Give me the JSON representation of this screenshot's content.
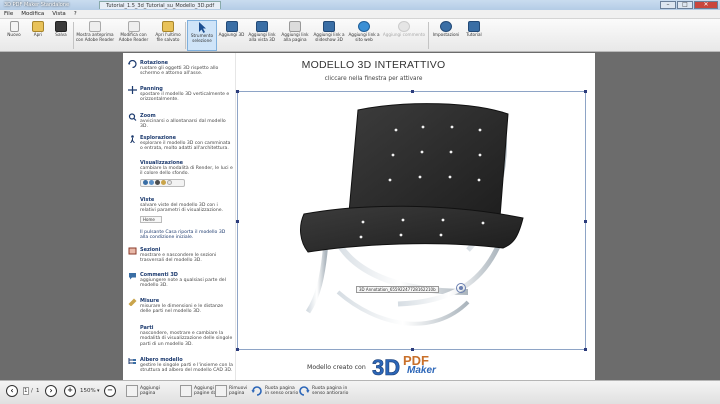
{
  "window": {
    "title": "3D PDF Maker Standalone",
    "document_tab": "Tutorial_1.5_3d_Tutorial_su_Modello_3D.pdf"
  },
  "menu": [
    "File",
    "Modifica",
    "Vista",
    "?"
  ],
  "toolbar": {
    "buttons": [
      {
        "label": "Nuovo",
        "icon": "new-document-icon",
        "state": "enabled"
      },
      {
        "label": "Apri",
        "icon": "folder-open-icon",
        "state": "enabled"
      },
      {
        "label": "Salva",
        "icon": "save-icon",
        "state": "enabled"
      },
      {
        "label": "Mostra anteprima con Adobe Reader",
        "icon": "preview-icon",
        "state": "enabled"
      },
      {
        "label": "Modifica con Adobe Reader",
        "icon": "edit-reader-icon",
        "state": "enabled"
      },
      {
        "label": "Apri l'ultimo file salvato",
        "icon": "open-last-icon",
        "state": "enabled"
      },
      {
        "label": "Strumento selezione",
        "icon": "cursor-icon",
        "state": "active"
      },
      {
        "label": "Aggiungi 3D",
        "icon": "add-3d-icon",
        "state": "enabled"
      },
      {
        "label": "Aggiungi link alla vista 3D",
        "icon": "link-3d-view-icon",
        "state": "enabled"
      },
      {
        "label": "Aggiungi link alla pagina",
        "icon": "link-page-icon",
        "state": "enabled"
      },
      {
        "label": "Aggiungi link a slideshow 3D",
        "icon": "link-slideshow-icon",
        "state": "enabled"
      },
      {
        "label": "Aggiungi link a sito web",
        "icon": "link-web-icon",
        "state": "enabled"
      },
      {
        "label": "Aggiungi commento",
        "icon": "comment-icon",
        "state": "disabled"
      },
      {
        "label": "Impostazioni",
        "icon": "settings-icon",
        "state": "enabled"
      },
      {
        "label": "Tutorial",
        "icon": "tutorial-icon",
        "state": "enabled"
      }
    ]
  },
  "page": {
    "title": "MODELLO 3D INTERATTIVO",
    "subtitle": "cliccare nella finestra per attivare",
    "tag": "3D Annotation_65592247728162210b",
    "credit": "Modello creato con",
    "logo_text": "3D",
    "logo_pdf": "PDF",
    "logo_maker": "Maker"
  },
  "instructions": [
    {
      "title": "Rotazione",
      "text": "ruotare gli oggetti 3D rispetto allo schermo e attorno all'asse."
    },
    {
      "title": "Panning",
      "text": "spostare il modello 3D verticalmente e orizzontalmente."
    },
    {
      "title": "Zoom",
      "text": "avvicinarsi o allontanarsi dal modello 3D."
    },
    {
      "title": "Esplorazione",
      "text": "esplorare il modello 3D con camminata o entrata, molto adatti all'architettura."
    },
    {
      "title": "Visualizzazione",
      "text": "cambiare la modalità di Render, le luci e il colore dello sfondo."
    },
    {
      "title": "Viste",
      "text": "salvare viste del modello 3D con i relativi parametri di visualizzazione."
    },
    {
      "title": "",
      "text": "Il pulsante Casa riporta il modello 3D alla condizione iniziale."
    },
    {
      "title": "Sezioni",
      "text": "mostrare e nascondere le sezioni trasversali del modello 3D."
    },
    {
      "title": "Commenti 3D",
      "text": "aggiungere note a qualsiasi parte del modello 3D."
    },
    {
      "title": "Misure",
      "text": "misurare le dimensioni e le distanze delle parti nel modello 3D."
    },
    {
      "title": "Parti",
      "text": "nascondere, mostrare e cambiare la modalità di visualizzazione delle singole parti di un modello 3D."
    },
    {
      "title": "Albero modello",
      "text": "gestire le singole parti e l'insieme con la struttura ad albero del modello CAD 3D."
    }
  ],
  "home_box": "Home",
  "bottombar": {
    "page_current": "1",
    "page_sep": "/",
    "page_total": "1",
    "zoom": "150%",
    "buttons": [
      {
        "label": "Aggiungi pagina",
        "icon": "add-page-icon"
      },
      {
        "label": "Aggiungi pagine da PDF",
        "icon": "add-pdf-pages-icon"
      },
      {
        "label": "Rimuovi pagina",
        "icon": "remove-page-icon"
      },
      {
        "label": "Ruota pagina in senso orario",
        "icon": "rotate-cw-icon"
      },
      {
        "label": "Ruota pagina in senso antiorario",
        "icon": "rotate-ccw-icon"
      }
    ]
  },
  "colors": {
    "accent": "#2c66b8",
    "brand_orange": "#c9702a",
    "chair_leather": "#2a2a2a",
    "frame": "#8ea4c6"
  }
}
